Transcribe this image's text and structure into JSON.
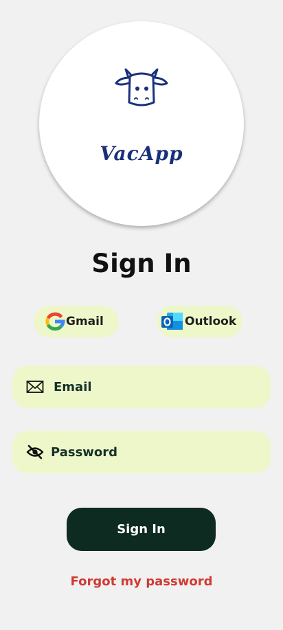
{
  "logo": {
    "text": "VacApp",
    "icon": "cow-face-icon",
    "color": "#19307a"
  },
  "page_title": "Sign In",
  "oauth": {
    "gmail": {
      "label": "Gmail",
      "icon": "google-g-icon"
    },
    "outlook": {
      "label": "Outlook",
      "icon": "outlook-icon"
    }
  },
  "form": {
    "email": {
      "label": "Email",
      "icon": "envelope-icon"
    },
    "password": {
      "label": "Password",
      "icon": "eye-off-icon"
    }
  },
  "actions": {
    "signin_label": "Sign In",
    "forgot_label": "Forgot my password"
  },
  "colors": {
    "background": "#f1f1f1",
    "field_bg": "#eef7c9",
    "primary_button": "#0e2b22",
    "link": "#cf3b34"
  }
}
